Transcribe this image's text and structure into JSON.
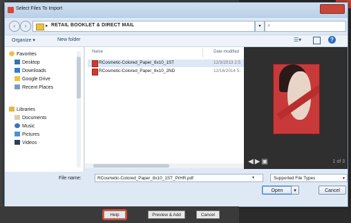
{
  "dialog": {
    "title": "Select Files To Import",
    "address_path": "RETAIL BOOKLET & DIRECT MAIL",
    "toolbar": {
      "organize": "Organize ▾",
      "new_folder": "New folder"
    }
  },
  "nav_pane": {
    "favorites_label": "Favorites",
    "favorites": [
      "Desktop",
      "Downloads",
      "Google Drive",
      "Recent Places"
    ],
    "libraries_label": "Libraries",
    "libraries": [
      "Documents",
      "Music",
      "Pictures",
      "Videos"
    ]
  },
  "file_list": {
    "col_name": "Name",
    "col_date": "Date modified",
    "files": [
      {
        "name": "RCosmetic-Colored_Paper_8x10_1ST",
        "date": "12/3/2013 2:5"
      },
      {
        "name": "RCosmetic-Colored_Paper_8x10_2ND",
        "date": "12/16/2014 5:"
      }
    ]
  },
  "preview": {
    "page_text": "1 of 3"
  },
  "file_name": {
    "label": "File name:",
    "value": "RCosmetic-Colored_Paper_8x10_1ST_PrHR.pdf"
  },
  "file_type": {
    "selected": "Supported File Types"
  },
  "buttons": {
    "open": "Open",
    "cancel": "Cancel"
  },
  "bottom_bar": {
    "help": "Help",
    "prev_label": "Preview & Add",
    "cancel": "Cancel"
  },
  "colors": {
    "highlight_outline": "#e0402d",
    "preview_red": "#c83a3a",
    "selection_bg": "#dde8f6"
  }
}
